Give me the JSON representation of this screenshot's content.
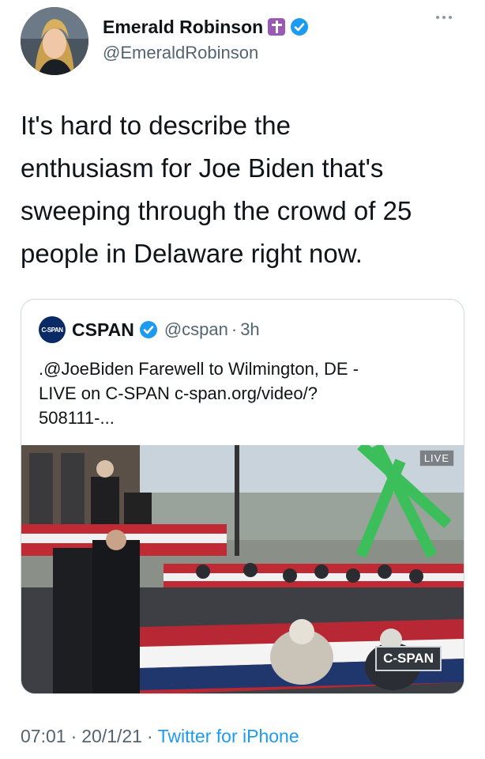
{
  "author": {
    "display_name": "Emerald Robinson",
    "handle": "@EmeraldRobinson",
    "badge_icon": "cross-emoji-icon",
    "verified": true
  },
  "tweet": {
    "text": "It's hard to describe the\nenthusiasm for Joe Biden that's\nsweeping through the crowd of 25\npeople in Delaware right now."
  },
  "quoted_tweet": {
    "logo_text": "C-SPAN",
    "display_name": "CSPAN",
    "handle": "@cspan",
    "separator": "·",
    "time": "3h",
    "text": ".@JoeBiden Farewell to Wilmington, DE -\nLIVE on C-SPAN c-span.org/video/?\n508111-...",
    "media": {
      "live_label": "LIVE",
      "watermark": "C-SPAN"
    }
  },
  "footer": {
    "time": "07:01",
    "date": "20/1/21",
    "separator": "·",
    "source": "Twitter for iPhone"
  },
  "colors": {
    "link": "#1d9bf0",
    "secondary_text": "#536471",
    "verified": "#1d9bf0"
  }
}
